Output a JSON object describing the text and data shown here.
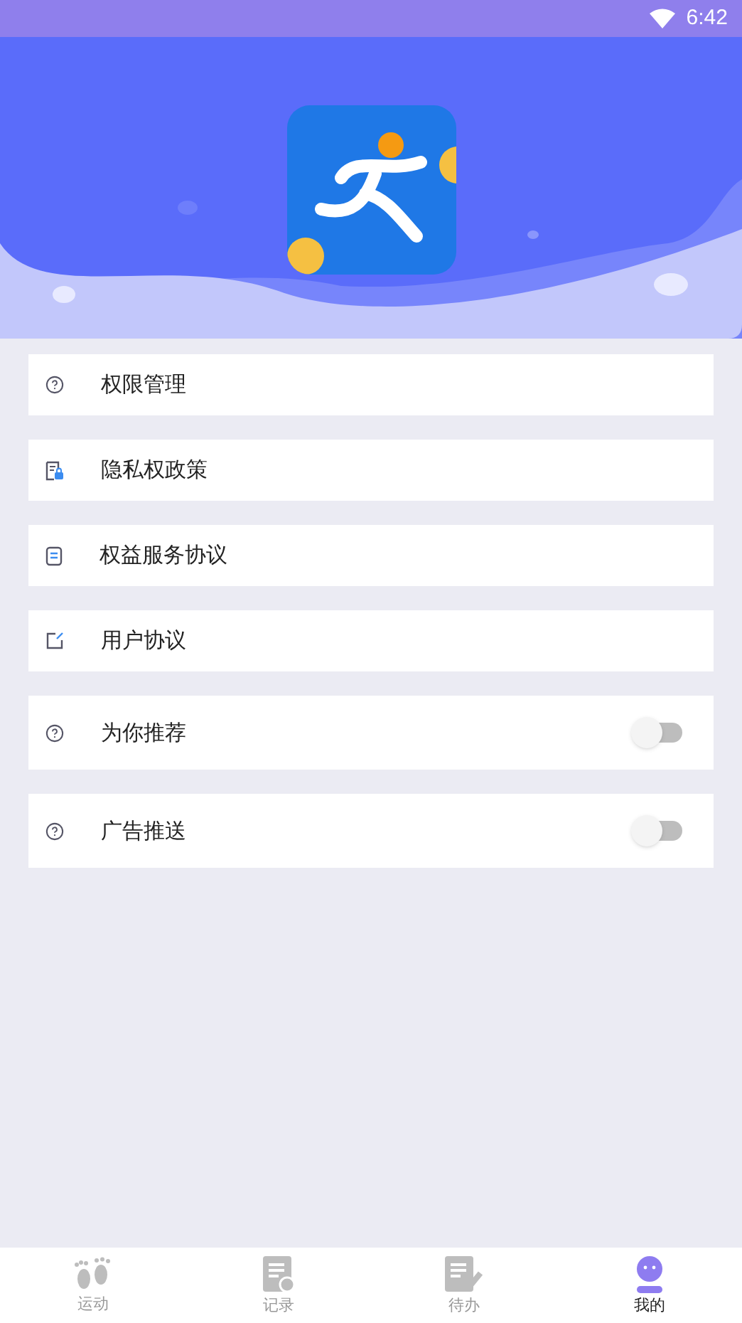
{
  "status_bar": {
    "time": "6:42"
  },
  "menu": [
    {
      "kind": "link",
      "label": "权限管理"
    },
    {
      "kind": "link",
      "label": "隐私权政策"
    },
    {
      "kind": "link",
      "label": "权益服务协议"
    },
    {
      "kind": "link",
      "label": "用户协议"
    },
    {
      "kind": "toggle",
      "label": "为你推荐",
      "on": false
    },
    {
      "kind": "toggle",
      "label": "广告推送",
      "on": false
    }
  ],
  "bottom_nav": [
    {
      "label": "运动",
      "selected": false
    },
    {
      "label": "记录",
      "selected": false
    },
    {
      "label": "待办",
      "selected": false
    },
    {
      "label": "我的",
      "selected": true
    }
  ]
}
